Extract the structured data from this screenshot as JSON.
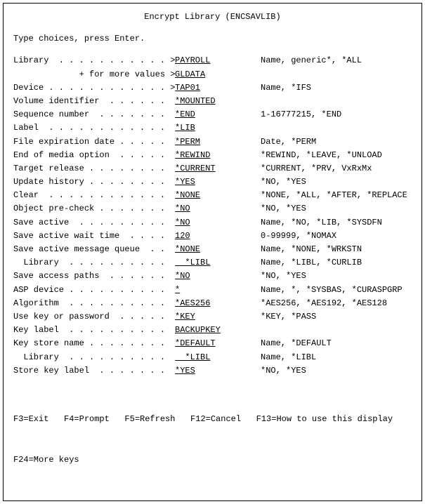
{
  "title": "Encrypt Library (ENCSAVLIB)",
  "instruction": "Type choices, press Enter.",
  "fields": [
    {
      "label": "Library  . . . . . . . . . . . > ",
      "value": "PAYROLL",
      "hint": "Name, generic*, *ALL",
      "wide": false
    },
    {
      "label": "             + for more values > ",
      "value": "GLDATA",
      "hint": "",
      "wide": false
    },
    {
      "label": "Device . . . . . . . . . . . . > ",
      "value": "TAP01",
      "hint": "Name, *IFS",
      "wide": false
    },
    {
      "label": "Volume identifier  . . . . . .   ",
      "value": "*MOUNTED",
      "hint": "",
      "wide": false
    },
    {
      "label": "Sequence number  . . . . . . .   ",
      "value": "*END",
      "hint": "1-16777215, *END",
      "wide": false
    },
    {
      "label": "Label  . . . . . . . . . . . .   ",
      "value": "*LIB",
      "hint": "",
      "wide": false
    },
    {
      "label": "File expiration date . . . . .   ",
      "value": "*PERM",
      "hint": "Date, *PERM",
      "wide": false
    },
    {
      "label": "End of media option  . . . . .   ",
      "value": "*REWIND",
      "hint": "*REWIND, *LEAVE, *UNLOAD",
      "wide": false
    },
    {
      "label": "Target release . . . . . . . .   ",
      "value": "*CURRENT",
      "hint": "*CURRENT, *PRV, VxRxMx",
      "wide": false
    },
    {
      "label": "Update history . . . . . . . .   ",
      "value": "*YES",
      "hint": "*NO, *YES",
      "wide": false
    },
    {
      "label": "Clear  . . . . . . . . . . . .   ",
      "value": "*NONE",
      "hint": "*NONE, *ALL, *AFTER, *REPLACE",
      "wide": false
    },
    {
      "label": "Object pre-check . . . . . . .   ",
      "value": "*NO",
      "hint": "*NO, *YES",
      "wide": false
    },
    {
      "label": "Save active  . . . . . . . . .   ",
      "value": "*NO",
      "hint": "Name, *NO, *LIB, *SYSDFN",
      "wide": false
    },
    {
      "label": "Save active wait time  . . . .   ",
      "value": "120",
      "hint": "0-99999, *NOMAX",
      "wide": false
    },
    {
      "label": "Save active message queue  . .   ",
      "value": "*NONE",
      "hint": "Name, *NONE, *WRKSTN",
      "wide": false
    },
    {
      "label": "  Library  . . . . . . . . . .   ",
      "value": "  *LIBL",
      "hint": "Name, *LIBL, *CURLIB",
      "wide": false
    },
    {
      "label": "Save access paths  . . . . . .   ",
      "value": "*NO",
      "hint": "*NO, *YES",
      "wide": false
    },
    {
      "label": "ASP device . . . . . . . . . .   ",
      "value": "*",
      "hint": "Name, *, *SYSBAS, *CURASPGRP",
      "wide": false
    },
    {
      "label": "Algorithm  . . . . . . . . . .   ",
      "value": "*AES256",
      "hint": "*AES256, *AES192, *AES128",
      "wide": false
    },
    {
      "label": "Use key or password  . . . . .   ",
      "value": "*KEY",
      "hint": "*KEY, *PASS",
      "wide": false
    },
    {
      "label": "Key label  . . . . . . . . . .   ",
      "value": "BACKUPKEY",
      "hint": "",
      "wide": true
    },
    {
      "label": "Key store name . . . . . . . .   ",
      "value": "*DEFAULT",
      "hint": "Name, *DEFAULT",
      "wide": false
    },
    {
      "label": "  Library  . . . . . . . . . .   ",
      "value": "  *LIBL",
      "hint": "Name, *LIBL",
      "wide": false
    },
    {
      "label": "Store key label  . . . . . . .   ",
      "value": "*YES",
      "hint": "*NO, *YES",
      "wide": false
    }
  ],
  "fkeys_line1": "F3=Exit   F4=Prompt   F5=Refresh   F12=Cancel   F13=How to use this display",
  "fkeys_line2": "F24=More keys"
}
